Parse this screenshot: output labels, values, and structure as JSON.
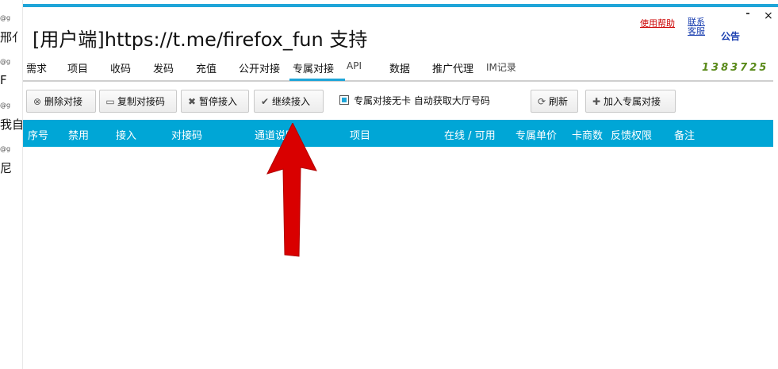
{
  "background_fragments": {
    "items": [
      {
        "text": "@g",
        "kind": "small"
      },
      {
        "text": "邢亻",
        "kind": "char"
      },
      {
        "text": "@g",
        "kind": "small"
      },
      {
        "text": "F",
        "kind": "char"
      },
      {
        "text": "@g",
        "kind": "small"
      },
      {
        "text": "我自",
        "kind": "char"
      },
      {
        "text": "@g",
        "kind": "small"
      },
      {
        "text": "尼",
        "kind": "char"
      }
    ]
  },
  "window": {
    "title_prefix": "[用户端]",
    "title_main": "https://t.me/firefox_fun 支持",
    "help_link": "使用帮助",
    "service_link_line1": "联系",
    "service_link_line2": "客服",
    "notice_link": "公告",
    "close_glyph": "×"
  },
  "menu": {
    "items": [
      {
        "label": "需求"
      },
      {
        "label": "项目"
      },
      {
        "label": "收码"
      },
      {
        "label": "发码"
      },
      {
        "label": "充值"
      },
      {
        "label": "公开对接"
      },
      {
        "label": "专属对接",
        "active": true
      },
      {
        "label": "API"
      },
      {
        "label": "数据"
      },
      {
        "label": "推广代理"
      },
      {
        "label": "IM记录"
      }
    ],
    "counter": "1383725"
  },
  "toolbar": {
    "buttons": [
      {
        "label": "删除对接",
        "icon": "delete-circle-icon",
        "glyph": "⊗"
      },
      {
        "label": "复制对接码",
        "icon": "folder-icon",
        "glyph": "▭"
      },
      {
        "label": "暂停接入",
        "icon": "pause-x-icon",
        "glyph": "✖"
      },
      {
        "label": "继续接入",
        "icon": "check-icon",
        "glyph": "✔"
      }
    ],
    "auto_label": "专属对接无卡 自动获取大厅号码",
    "refresh_label": "刷新",
    "refresh_glyph": "⟳",
    "add_label": "加入专属对接",
    "add_glyph": "✚"
  },
  "table": {
    "headers": [
      "序号",
      "禁用",
      "接入",
      "对接码",
      "通道说明",
      "项目",
      "在线 / 可用",
      "专属单价",
      "卡商数",
      "反馈权限",
      "备注"
    ]
  },
  "colors": {
    "accent": "#00a6d6",
    "arrow": "#d90000",
    "counter": "#5a8a1a"
  }
}
